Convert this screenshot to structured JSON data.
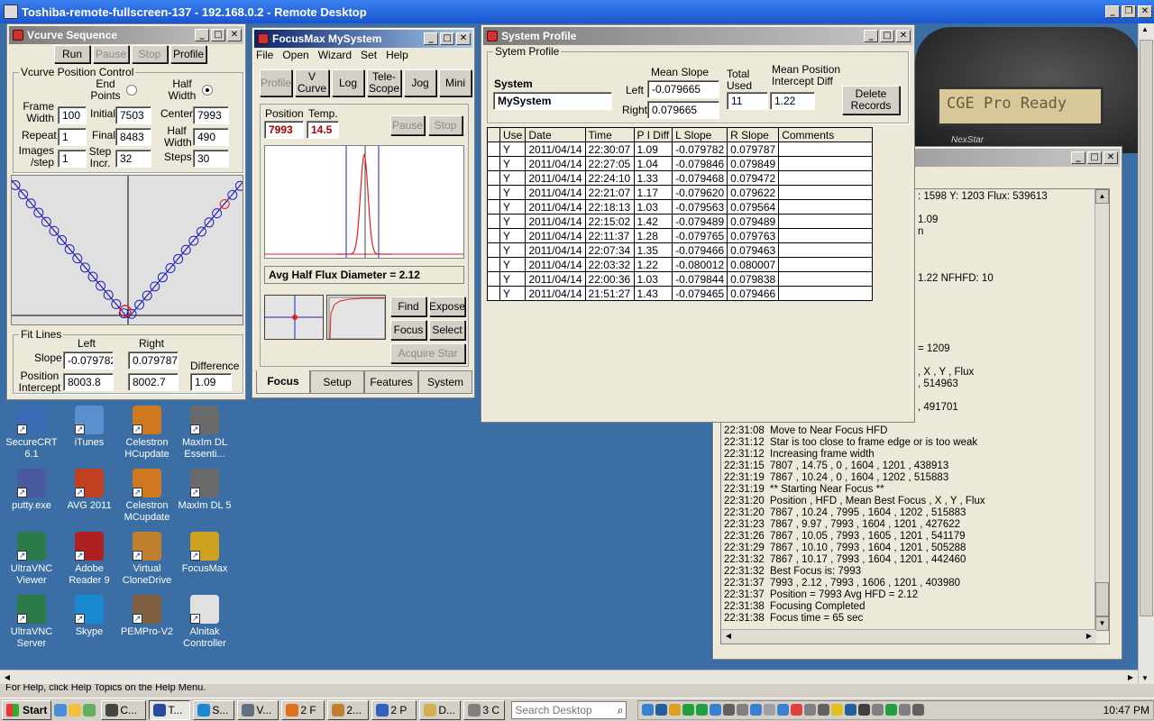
{
  "remote_title": "Toshiba-remote-fullscreen-137 - 192.168.0.2 - Remote Desktop",
  "colors": {
    "title_active": "#0a246a",
    "title_inactive": "#7b7b7b",
    "desktop": "#3a6ea5",
    "curve": "#e02020",
    "vcurve": "#2020c0"
  },
  "vcurve": {
    "title": "Vcurve Sequence",
    "buttons": [
      "Run",
      "Pause",
      "Stop",
      "Profile"
    ],
    "group_title": "Vcurve Position Control",
    "end_points": "End Points",
    "half_width": "Half Width",
    "frame_width_label": "Frame Width",
    "frame_width": "100",
    "initial_label": "Initial",
    "initial": "7503",
    "center_label": "Center",
    "center": "7993",
    "repeat_label": "Repeat",
    "repeat": "1",
    "final_label": "Final",
    "final": "8483",
    "half_width_label": "Half Width",
    "half_width_value": "490",
    "images_label": "Images /step",
    "images": "1",
    "step_incr_label": "Step Incr.",
    "step_incr": "32",
    "steps_label": "Steps",
    "steps": "30",
    "fit_lines_title": "Fit Lines",
    "left_label": "Left",
    "right_label": "Right",
    "slope_label": "Slope",
    "slope_left": "-0.079782",
    "slope_right": "0.079787",
    "difference_label": "Difference",
    "pos_intercept_label": "Position Intercept",
    "intercept_left": "8003.8",
    "intercept_right": "8002.7",
    "difference": "1.09"
  },
  "focusmax": {
    "title": "FocusMax  MySystem",
    "menu": [
      "File",
      "Open",
      "Wizard",
      "Set",
      "Help"
    ],
    "toolbar": [
      "Profile",
      "V Curve",
      "Log",
      "Tele- Scope",
      "Jog",
      "Mini"
    ],
    "position_label": "Position",
    "temp_label": "Temp.",
    "position": "7993",
    "temp": "14.5",
    "pause": "Pause",
    "stop": "Stop",
    "hfd_text": "Avg Half Flux Diameter = 2.12",
    "find": "Find",
    "expose": "Expose",
    "focus": "Focus",
    "select": "Select",
    "acquire": "Acquire Star",
    "tabs": [
      "Focus",
      "Setup",
      "Features",
      "System"
    ]
  },
  "profile": {
    "title": "System Profile",
    "group_title": "Sytem Profile",
    "system_label": "System",
    "system": "MySystem",
    "mean_slope_label": "Mean Slope",
    "left_label": "Left",
    "left": "-0.079665",
    "right_label": "Right",
    "right": "0.079665",
    "total_used_label": "Total Used",
    "total_used": "11",
    "mean_pos_label": "Mean Position Intercept Diff",
    "mean_pos": "1.22",
    "delete_button": "Delete Records",
    "columns": [
      "",
      "Use",
      "Date",
      "Time",
      "P I Diff",
      "L Slope",
      "R Slope",
      "Comments"
    ],
    "rows": [
      [
        "Y",
        "2011/04/14",
        "22:30:07",
        "1.09",
        "-0.079782",
        "0.079787"
      ],
      [
        "Y",
        "2011/04/14",
        "22:27:05",
        "1.04",
        "-0.079846",
        "0.079849"
      ],
      [
        "Y",
        "2011/04/14",
        "22:24:10",
        "1.33",
        "-0.079468",
        "0.079472"
      ],
      [
        "Y",
        "2011/04/14",
        "22:21:07",
        "1.17",
        "-0.079620",
        "0.079622"
      ],
      [
        "Y",
        "2011/04/14",
        "22:18:13",
        "1.03",
        "-0.079563",
        "0.079564"
      ],
      [
        "Y",
        "2011/04/14",
        "22:15:02",
        "1.42",
        "-0.079489",
        "0.079489"
      ],
      [
        "Y",
        "2011/04/14",
        "22:11:37",
        "1.28",
        "-0.079765",
        "0.079763"
      ],
      [
        "Y",
        "2011/04/14",
        "22:07:34",
        "1.35",
        "-0.079466",
        "0.079463"
      ],
      [
        "Y",
        "2011/04/14",
        "22:03:32",
        "1.22",
        "-0.080012",
        "0.080007"
      ],
      [
        "Y",
        "2011/04/14",
        "22:00:36",
        "1.03",
        "-0.079844",
        "0.079838"
      ],
      [
        "Y",
        "2011/04/14",
        "21:51:27",
        "1.43",
        "-0.079465",
        "0.079466"
      ]
    ]
  },
  "hc": {
    "text": "CGE Pro Ready",
    "brand": "NexStar"
  },
  "log": {
    "partial": [
      ": 1598 Y: 1203 Flux: 539613",
      "1.09",
      "n",
      "1.22 NFHFD: 10",
      "= 1209",
      ", X , Y , Flux",
      ", 514963",
      ", 491701"
    ],
    "lines": [
      [
        "22:31:08",
        "Move to Near Focus HFD"
      ],
      [
        "22:31:12",
        "Star is too close to frame edge or is too weak"
      ],
      [
        "22:31:12",
        "Increasing frame width"
      ],
      [
        "22:31:15",
        "7807  ,  14.75  ,  0  ,  1604  ,  1201  ,  438913"
      ],
      [
        "22:31:19",
        "7867  ,  10.24  ,  0  ,  1604  ,  1202  ,  515883"
      ],
      [
        "22:31:19",
        "** Starting Near Focus **"
      ],
      [
        "22:31:20",
        "Position , HFD , Mean Best Focus , X , Y , Flux"
      ],
      [
        "22:31:20",
        "7867  ,  10.24  ,  7995  ,  1604  ,  1202  ,  515883"
      ],
      [
        "22:31:23",
        "7867  ,  9.97  ,  7993  ,  1604  ,  1201  ,  427622"
      ],
      [
        "22:31:26",
        "7867  ,  10.05  ,  7993  ,  1605  ,  1201  ,  541179"
      ],
      [
        "22:31:29",
        "7867  ,  10.10  ,  7993  ,  1604  ,  1201  ,  505288"
      ],
      [
        "22:31:32",
        "7867  ,  10.17  ,  7993  ,  1604  ,  1201  ,  442460"
      ],
      [
        "22:31:32",
        "Best Focus is: 7993"
      ],
      [
        "22:31:37",
        "7993  ,  2.12  ,  7993  ,  1606  ,  1201  ,  403980"
      ],
      [
        "22:31:37",
        "Position = 7993  Avg HFD =  2.12"
      ],
      [
        "22:31:38",
        "Focusing Completed"
      ],
      [
        "22:31:38",
        "Focus time = 65 sec"
      ]
    ]
  },
  "desktop_icons": [
    {
      "label": "SecureCRT 6.1",
      "icon": "securecrt-icon"
    },
    {
      "label": "iTunes",
      "icon": "itunes-icon"
    },
    {
      "label": "Celestron HCupdate",
      "icon": "hcupdate-icon"
    },
    {
      "label": "MaxIm DL Essenti...",
      "icon": "maxim-icon"
    },
    {
      "label": "putty.exe",
      "icon": "putty-icon"
    },
    {
      "label": "AVG 2011",
      "icon": "avg-icon"
    },
    {
      "label": "Celestron MCupdate",
      "icon": "mcupdate-icon"
    },
    {
      "label": "MaxIm DL 5",
      "icon": "maxim5-icon"
    },
    {
      "label": "UltraVNC Viewer",
      "icon": "ultravnc-icon"
    },
    {
      "label": "Adobe Reader 9",
      "icon": "adobe-icon"
    },
    {
      "label": "Virtual CloneDrive",
      "icon": "clonedrive-icon"
    },
    {
      "label": "FocusMax",
      "icon": "focusmax-icon"
    },
    {
      "label": "UltraVNC Server",
      "icon": "ultravnc-server-icon"
    },
    {
      "label": "Skype",
      "icon": "skype-icon"
    },
    {
      "label": "PEMPro-V2",
      "icon": "pempro-icon"
    },
    {
      "label": "Alnitak Controller",
      "icon": "alnitak-icon"
    }
  ],
  "status_text": "For Help, click Help Topics on the Help Menu.",
  "taskbar": {
    "start": "Start",
    "buttons": [
      "C...",
      "T...",
      "S...",
      "V...",
      "2 F",
      "2...",
      "2 P",
      "D...",
      "3 C"
    ],
    "search_placeholder": "Search Desktop",
    "clock": "10:47 PM"
  }
}
